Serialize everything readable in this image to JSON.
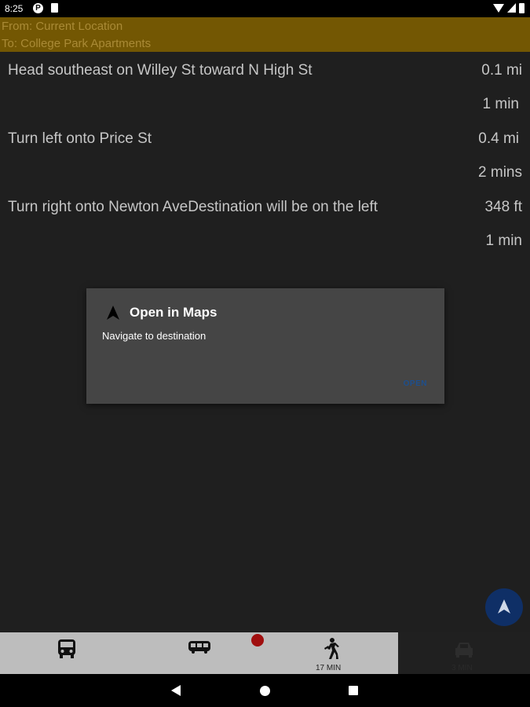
{
  "status_bar": {
    "time": "8:25",
    "icons": [
      "notification-p-icon",
      "sd-card-icon",
      "wifi-icon",
      "signal-icon",
      "battery-icon"
    ]
  },
  "route": {
    "from": "From: Current Location",
    "to": "To: College Park Apartments"
  },
  "steps": [
    {
      "instruction": "Head southeast on Willey St toward N High St",
      "distance": "0.1 mi",
      "duration": "1 min"
    },
    {
      "instruction": "Turn left onto Price St",
      "distance": "0.4 mi",
      "duration": "2 mins"
    },
    {
      "instruction": "Turn right onto Newton AveDestination will be on the left",
      "distance": "348 ft",
      "duration": "1 min"
    }
  ],
  "dialog": {
    "icon": "navigation-arrow-icon",
    "title": "Open in Maps",
    "message": "Navigate to destination",
    "open_label": "OPEN"
  },
  "fab": {
    "icon": "navigation-arrow-icon"
  },
  "tabs": [
    {
      "icon": "bus-icon",
      "label": ""
    },
    {
      "icon": "tram-icon",
      "label": ""
    },
    {
      "icon": "walking-icon",
      "label": "17 MIN"
    },
    {
      "icon": "car-icon",
      "label": "3 MIN"
    }
  ],
  "colors": {
    "background": "#1f1f1f",
    "header": "#735703",
    "dialog": "#454545",
    "fab": "#0f2f66",
    "tab_bar": "#bdbdbd",
    "alert_dot": "#a00e0e"
  }
}
